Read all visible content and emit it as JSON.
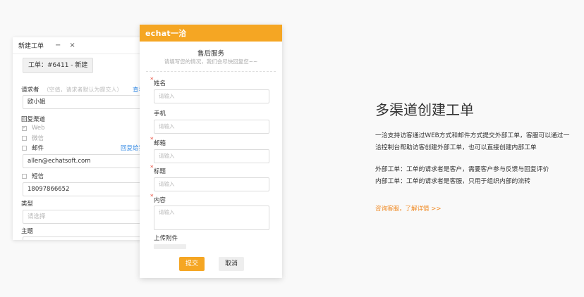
{
  "ticket_window": {
    "title": "新建工单",
    "minimize": "−",
    "close": "×",
    "ticket_id": "工单：#6411 - 新建",
    "requester_label": "请求者",
    "requester_hint": "（空值，请求者默认为提交人）",
    "requester_link": "查看",
    "requester_value": "欧小姐",
    "reply_channel_label": "回复渠道",
    "channel_web": "Web",
    "channel_wechat": "微信",
    "channel_email": "邮件",
    "reply_link": "回复给我",
    "email_value": "allen@echatsoft.com",
    "channel_sms": "短信",
    "phone_value": "18097866652",
    "type_label": "类型",
    "type_placeholder": "请选择",
    "type_arrow": "▼",
    "subject_label": "主题"
  },
  "form": {
    "logo": "echat一洽",
    "title": "售后服务",
    "subtitle": "请填写您的情况，我们会尽快回复您~~",
    "required_mark": "*",
    "fields": [
      {
        "label": "姓名",
        "placeholder": "请输入",
        "required": true
      },
      {
        "label": "手机",
        "placeholder": "请输入",
        "required": false
      },
      {
        "label": "邮箱",
        "placeholder": "请输入",
        "required": true
      },
      {
        "label": "标题",
        "placeholder": "请输入",
        "required": true
      },
      {
        "label": "内容",
        "placeholder": "请输入",
        "required": true
      }
    ],
    "upload_label": "上传附件",
    "submit": "提交",
    "cancel": "取消"
  },
  "content": {
    "headline": "多渠道创建工单",
    "para1_line1": "一洽支持访客通过WEB方式和邮件方式提交外部工单，客服可以通过一",
    "para1_line2": "洽控制台帮助访客创建外部工单，也可以直接创建内部工单",
    "para2_line1": "外部工单：工单的请求者是客户，需要客户参与反馈与回复评价",
    "para2_line2": "内部工单：工单的请求者是客服，只用于组织内部的流转",
    "cta": "咨询客服，了解详情 >>"
  },
  "colors": {
    "brand": "#f5a623",
    "link": "#3a8ee6",
    "cta": "#f08a24",
    "required": "#e74c3c"
  }
}
